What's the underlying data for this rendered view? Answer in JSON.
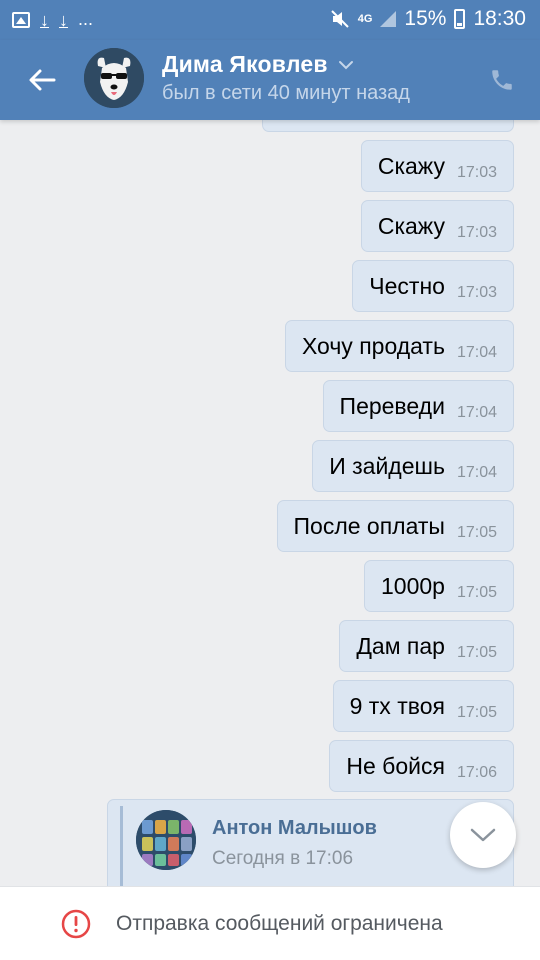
{
  "status_bar": {
    "left_icons": [
      "gallery-icon",
      "download-icon",
      "download-icon"
    ],
    "ellipsis": "...",
    "network": "4G",
    "battery_percent": "15%",
    "time": "18:30"
  },
  "header": {
    "contact_name": "Дима Яковлев",
    "last_seen": "был в сети 40 минут назад",
    "back_icon": "arrow-left-icon",
    "call_icon": "phone-icon",
    "accent_color": "#5181b8"
  },
  "messages": [
    {
      "text": "Скажу",
      "time": "17:03"
    },
    {
      "text": "Скажу",
      "time": "17:03"
    },
    {
      "text": "Честно",
      "time": "17:03"
    },
    {
      "text": "Хочу продать",
      "time": "17:04"
    },
    {
      "text": "Переведи",
      "time": "17:04"
    },
    {
      "text": "И зайдешь",
      "time": "17:04"
    },
    {
      "text": "После оплаты",
      "time": "17:05"
    },
    {
      "text": "1000р",
      "time": "17:05"
    },
    {
      "text": "Дам пар",
      "time": "17:05"
    },
    {
      "text": "9 тх твоя",
      "time": "17:05"
    },
    {
      "text": "Не бойся",
      "time": "17:06"
    }
  ],
  "forwarded": {
    "author": "Антон Малышов",
    "time": "Сегодня в 17:06"
  },
  "footer": {
    "restriction": "Отправка сообщений ограничена",
    "warning_color": "#e64646"
  }
}
